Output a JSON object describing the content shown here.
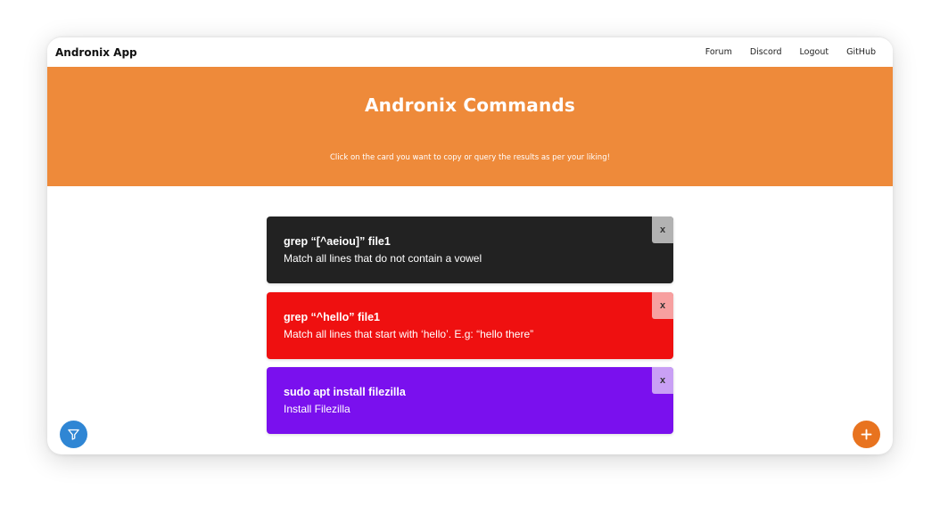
{
  "navbar": {
    "brand": "Andronix App",
    "links": [
      "Forum",
      "Discord",
      "Logout",
      "GitHub"
    ]
  },
  "hero": {
    "title": "Andronix Commands",
    "subtitle": "Click on the card you want to copy or query the results as per your liking!",
    "background_color": "#ee8a3a"
  },
  "cards": [
    {
      "command": "grep “[^aeiou]” file1",
      "description": "Match all lines that do not contain a vowel",
      "close_label": "x",
      "color": "#222222"
    },
    {
      "command": "grep “^hello” file1",
      "description": "Match all lines that start with ‘hello’. E.g: “hello there”",
      "close_label": "x",
      "color": "#ef1010"
    },
    {
      "command": "sudo apt install filezilla",
      "description": "Install Filezilla",
      "close_label": "x",
      "color": "#7a10ee"
    }
  ],
  "fabs": {
    "filter_icon": "filter-icon",
    "filter_color": "#2f86d4",
    "add_icon": "plus-icon",
    "add_color": "#e8731f"
  }
}
